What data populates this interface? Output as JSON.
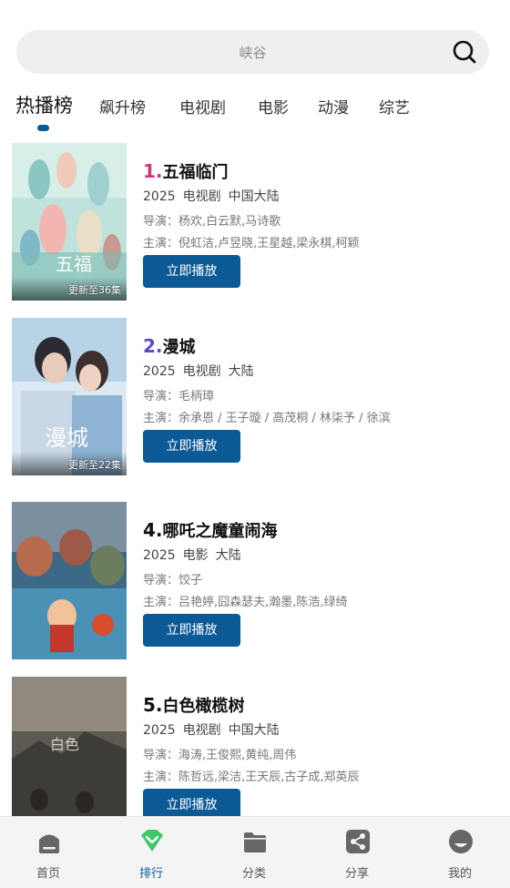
{
  "search": {
    "placeholder": "峡谷"
  },
  "tabs": [
    {
      "label": "热播榜",
      "active": true
    },
    {
      "label": "飙升榜"
    },
    {
      "label": "电视剧"
    },
    {
      "label": "电影"
    },
    {
      "label": "动漫"
    },
    {
      "label": "综艺"
    }
  ],
  "items": [
    {
      "rank": "1.",
      "rank_color": "#d0327d",
      "title": "五福临门",
      "year": "2025",
      "genre": "电视剧",
      "region": "中国大陆",
      "director": "导演：杨欢,白云默,马诗歌",
      "cast": "主演：倪虹洁,卢昱晓,王星越,梁永棋,柯颖",
      "badge": "更新至36集",
      "play_label": "立即播放"
    },
    {
      "rank": "2.",
      "rank_color": "#5a48c8",
      "title": "漫城",
      "year": "2025",
      "genre": "电视剧",
      "region": "大陆",
      "director": "导演：毛柄璋",
      "cast": "主演：余承恩 / 王子璇 / 高茂桐 / 林柒予 / 徐滨",
      "badge": "更新至22集",
      "play_label": "立即播放"
    },
    {
      "rank": "4.",
      "rank_color": "#111111",
      "title": "哪吒之魔童闹海",
      "year": "2025",
      "genre": "电影",
      "region": "大陆",
      "director": "导演：饺子",
      "cast": "主演：吕艳婷,囧森瑟夫,瀚墨,陈浩,绿绮",
      "badge": "",
      "play_label": "立即播放"
    },
    {
      "rank": "5.",
      "rank_color": "#111111",
      "title": "白色橄榄树",
      "year": "2025",
      "genre": "电视剧",
      "region": "中国大陆",
      "director": "导演：海涛,王俊熙,黄纯,周伟",
      "cast": "主演：陈哲远,梁洁,王天辰,古子成,郑英辰",
      "badge": "",
      "play_label": "立即播放"
    }
  ],
  "nav": [
    {
      "label": "首页",
      "icon": "home-icon"
    },
    {
      "label": "排行",
      "icon": "ranking-icon",
      "active": true
    },
    {
      "label": "分类",
      "icon": "folder-icon"
    },
    {
      "label": "分享",
      "icon": "share-icon"
    },
    {
      "label": "我的",
      "icon": "profile-icon"
    }
  ],
  "colors": {
    "accent": "#0b5a96",
    "ranking_icon": "#3fc86a"
  }
}
